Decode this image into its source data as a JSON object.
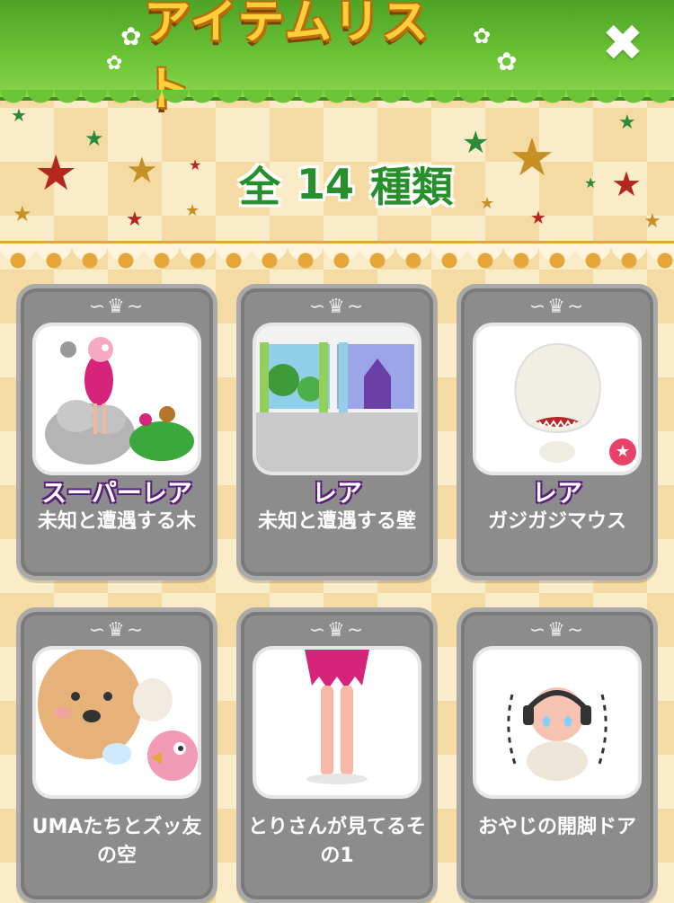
{
  "header": {
    "title": "アイテムリスト"
  },
  "count": {
    "prefix": "全",
    "number": "14",
    "suffix": "種類"
  },
  "items": [
    {
      "badge": "スーパーレア",
      "name": "未知と遭遇する木"
    },
    {
      "badge": "レア",
      "name": "未知と遭遇する壁"
    },
    {
      "badge": "レア",
      "name": "ガジガジマウス"
    },
    {
      "badge": "",
      "name": "UMAたちとズッ友の空"
    },
    {
      "badge": "",
      "name": "とりさんが見てるその1"
    },
    {
      "badge": "",
      "name": "おやじの開脚ドア"
    }
  ],
  "icons": {
    "close": "close-icon",
    "new": "star-badge-icon",
    "flower": "flower-icon",
    "star": "star-icon"
  },
  "colors": {
    "header_green": "#6cc436",
    "title_gold": "#ffcf3a",
    "count_green": "#27902c",
    "card_gray": "#8c8c8c",
    "new_badge": "#e8426a"
  }
}
